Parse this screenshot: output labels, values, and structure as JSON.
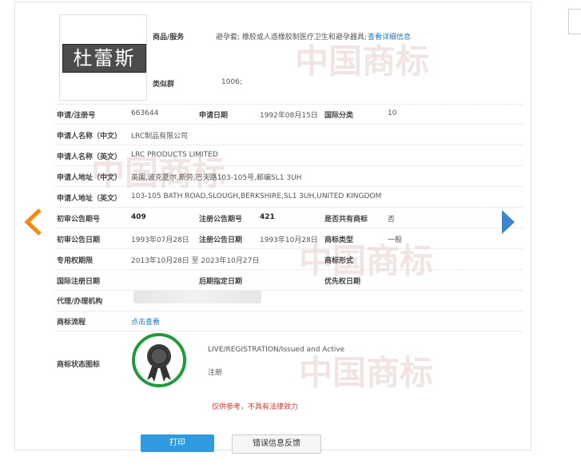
{
  "logo": {
    "text": "杜蕾斯"
  },
  "goods": {
    "label": "商品/服务",
    "value": "避孕套; 橡胶或人造橡胶制医疗卫生和避孕器具;",
    "link": "查看详细信息"
  },
  "similar_group": {
    "label": "类似群",
    "value": "1006;"
  },
  "row1": {
    "reg_no_label": "申请/注册号",
    "reg_no": "663644",
    "apply_date_label": "申请日期",
    "apply_date": "1992年08月15日",
    "intl_class_label": "国际分类",
    "intl_class": "10"
  },
  "applicant_cn": {
    "label": "申请人名称（中文）",
    "value": "LRC制品有限公司"
  },
  "applicant_en": {
    "label": "申请人名称（英文）",
    "value": "LRC PRODUCTS LIMITED"
  },
  "address_cn": {
    "label": "申请人地址（中文）",
    "value": "英国,波克夏尔,斯劳,巴夫路103-105号,邮编SL1 3UH"
  },
  "address_en": {
    "label": "申请人地址（英文）",
    "value": "103-105 BATH ROAD,SLOUGH,BERKSHIRE,SL1 3UH,UNITED KINGDOM"
  },
  "row_pub_no": {
    "prelim_no_label": "初审公告期号",
    "prelim_no": "409",
    "reg_pub_no_label": "注册公告期号",
    "reg_pub_no": "421",
    "shared_label": "是否共有商标",
    "shared": "否"
  },
  "row_pub_date": {
    "prelim_date_label": "初审公告日期",
    "prelim_date": "1993年07月28日",
    "reg_pub_date_label": "注册公告日期",
    "reg_pub_date": "1993年10月28日",
    "type_label": "商标类型",
    "type": "一般"
  },
  "row_right": {
    "period_label": "专用权期限",
    "period": "2013年10月28日 至 2023年10月27日",
    "form_label": "商标形式"
  },
  "row_intl": {
    "intl_reg_label": "国际注册日期",
    "later_label": "后期指定日期",
    "priority_label": "优先权日期"
  },
  "agent": {
    "label": "代理/办理机构"
  },
  "process": {
    "label": "商标流程",
    "link": "点击查看"
  },
  "status": {
    "label": "商标状态图标",
    "en": "LIVE/REGISTRATION/Issued and Active",
    "cn": "注册"
  },
  "notice": "仅供参考，不具有法律效力",
  "buttons": {
    "print": "打印",
    "feedback": "错误信息反馈"
  },
  "watermark": {
    "text": "中国商标"
  },
  "colors": {
    "link": "#1e74c6",
    "notice": "#d33333",
    "print_button": "#2f9ae0",
    "seal_ring": "#1f9a3a",
    "arrow_left": "#ef8a17",
    "arrow_right": "#3d86cc"
  }
}
